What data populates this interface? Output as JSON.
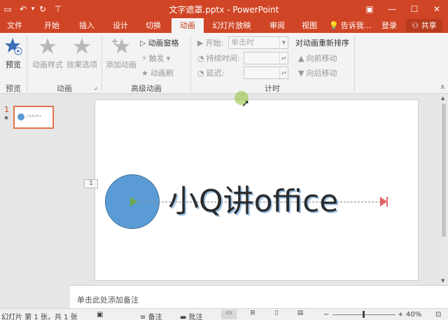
{
  "window": {
    "title": "文字遮罩.pptx - PowerPoint",
    "controls": {
      "ribbon_display": "▣",
      "minimize": "—",
      "maximize": "☐",
      "close": "✕"
    }
  },
  "qat": {
    "save": "▭",
    "undo": "↶",
    "undo_dropdown": "▾",
    "repeat": "↻",
    "customize": "⊤"
  },
  "tabs": [
    {
      "label": "文件"
    },
    {
      "label": "开始"
    },
    {
      "label": "插入"
    },
    {
      "label": "设计"
    },
    {
      "label": "切换"
    },
    {
      "label": "动画",
      "active": true
    },
    {
      "label": "幻灯片放映"
    },
    {
      "label": "审阅"
    },
    {
      "label": "视图"
    }
  ],
  "tell_me": "告诉我...",
  "login": "登录",
  "share": "共享",
  "ribbon": {
    "preview_group": {
      "label": "预览",
      "preview_button": "预览"
    },
    "animation_group": {
      "label": "动画",
      "animation_styles": "动画样式",
      "effect_options": "效果选项"
    },
    "advanced_group": {
      "label": "高级动画",
      "add_animation": "添加动画",
      "animation_pane": "动画窗格",
      "trigger": "触发",
      "trigger_dropdown": "▾",
      "animation_painter": "动画刷"
    },
    "timing_group": {
      "label": "计时",
      "start_label": "开始:",
      "start_value": "单击时",
      "duration_label": "持续时间:",
      "delay_label": "延迟:",
      "reorder_title": "对动画重新排序",
      "move_earlier": "向前移动",
      "move_later": "向后移动"
    },
    "collapse": "∧"
  },
  "thumbnails": {
    "number": "1",
    "star": "★",
    "mini_text": "小Q讲office"
  },
  "slide": {
    "anim_tag": "1",
    "text": "小Q讲office"
  },
  "notes": {
    "placeholder": "单击此处添加备注"
  },
  "statusbar": {
    "slide_info": "幻灯片 第 1 张，共 1 张",
    "notes_btn": "备注",
    "comments_btn": "批注",
    "zoom_minus": "−",
    "zoom_plus": "+",
    "zoom": "40%",
    "zoom_level_percent": 40,
    "fit": "⊡"
  },
  "colors": {
    "accent": "#d04525",
    "shape": "#5b9bd5"
  }
}
